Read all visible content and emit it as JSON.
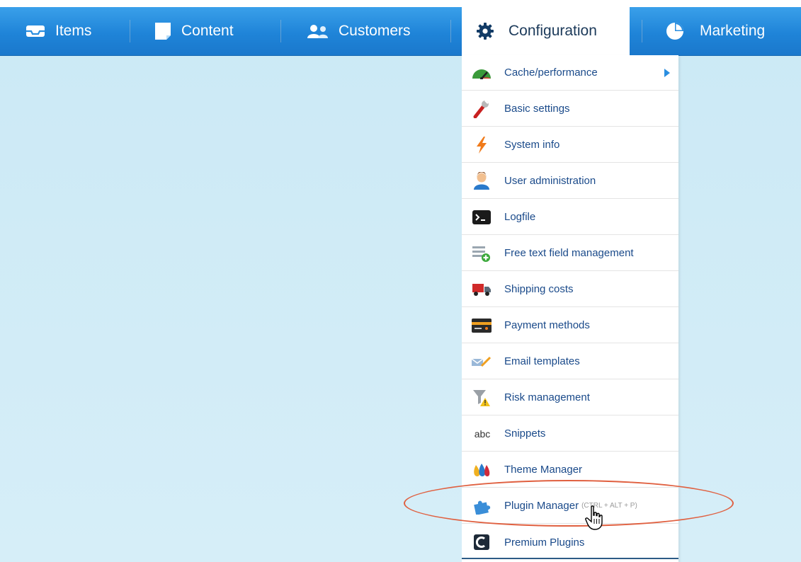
{
  "nav": {
    "items": [
      {
        "label": "Items",
        "icon": "inbox-icon"
      },
      {
        "label": "Content",
        "icon": "document-icon"
      },
      {
        "label": "Customers",
        "icon": "users-icon"
      },
      {
        "label": "Configuration",
        "icon": "gear-icon"
      },
      {
        "label": "Marketing",
        "icon": "pie-chart-icon"
      }
    ],
    "active": "Configuration"
  },
  "menu": {
    "items": [
      {
        "label": "Cache/performance",
        "icon": "speedometer-icon",
        "has_submenu": true
      },
      {
        "label": "Basic settings",
        "icon": "wrench-icon"
      },
      {
        "label": "System info",
        "icon": "lightning-icon"
      },
      {
        "label": "User administration",
        "icon": "user-icon"
      },
      {
        "label": "Logfile",
        "icon": "terminal-icon"
      },
      {
        "label": "Free text field management",
        "icon": "add-field-icon"
      },
      {
        "label": "Shipping costs",
        "icon": "truck-icon"
      },
      {
        "label": "Payment methods",
        "icon": "credit-card-icon"
      },
      {
        "label": "Email templates",
        "icon": "email-edit-icon"
      },
      {
        "label": "Risk management",
        "icon": "filter-warning-icon"
      },
      {
        "label": "Snippets",
        "icon": "abc-icon"
      },
      {
        "label": "Theme Manager",
        "icon": "paint-drops-icon"
      },
      {
        "label": "Plugin Manager",
        "icon": "puzzle-icon",
        "shortcut": "(CTRL + ALT + P)"
      },
      {
        "label": "Premium Plugins",
        "icon": "shopware-logo-icon"
      }
    ]
  },
  "snippets_icon_text": "abc",
  "colors": {
    "nav_bg": "#1f84d8",
    "canvas_bg": "#cbe9f5",
    "menu_text": "#1a4a8a",
    "highlight": "#e06040"
  }
}
